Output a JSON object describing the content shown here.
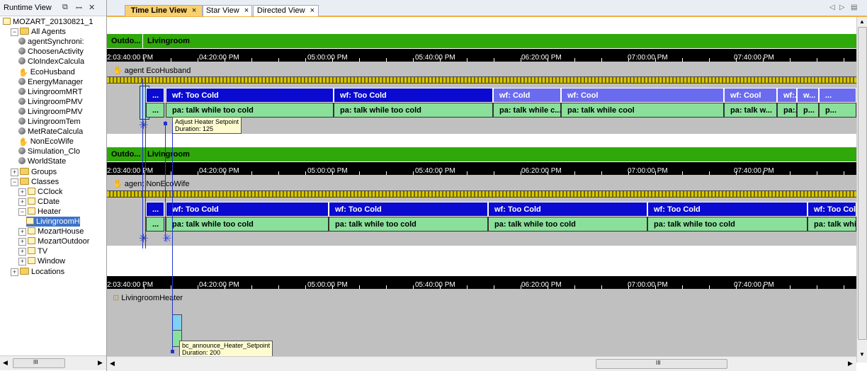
{
  "left_panel": {
    "title": "Runtime View",
    "icons": [
      "restore-icon",
      "pin-icon",
      "close-icon"
    ],
    "tree": [
      {
        "label": "MOZART_20130821_1",
        "icon": "db-icon",
        "level": 0
      },
      {
        "label": "All Agents",
        "icon": "folder-icon",
        "level": 1,
        "expanded": true
      },
      {
        "label": "agentSynchroni:",
        "icon": "ball-icon",
        "level": 2
      },
      {
        "label": "ChoosenActivity",
        "icon": "ball-icon",
        "level": 2
      },
      {
        "label": "CloIndexCalcula",
        "icon": "ball-icon",
        "level": 2
      },
      {
        "label": "EcoHusband",
        "icon": "hand-icon",
        "level": 2
      },
      {
        "label": "EnergyManager",
        "icon": "ball-icon",
        "level": 2
      },
      {
        "label": "LivingroomMRT",
        "icon": "ball-icon",
        "level": 2
      },
      {
        "label": "LivingroomPMV",
        "icon": "ball-icon",
        "level": 2
      },
      {
        "label": "LivingroomPMV",
        "icon": "ball-icon",
        "level": 2
      },
      {
        "label": "LivingroomTem",
        "icon": "ball-icon",
        "level": 2
      },
      {
        "label": "MetRateCalcula",
        "icon": "ball-icon",
        "level": 2
      },
      {
        "label": "NonEcoWife",
        "icon": "hand-icon",
        "level": 2
      },
      {
        "label": "Simulation_Clo",
        "icon": "ball-icon",
        "level": 2
      },
      {
        "label": "WorldState",
        "icon": "ball-icon",
        "level": 2
      },
      {
        "label": "Groups",
        "icon": "folder-icon",
        "level": 1,
        "expanded": false
      },
      {
        "label": "Classes",
        "icon": "folder-icon",
        "level": 1,
        "expanded": true
      },
      {
        "label": "CClock",
        "icon": "class-icon",
        "level": 2,
        "expanded": false
      },
      {
        "label": "CDate",
        "icon": "class-icon",
        "level": 2,
        "expanded": false
      },
      {
        "label": "Heater",
        "icon": "class-icon",
        "level": 2,
        "expanded": true
      },
      {
        "label": "LivingroomH",
        "icon": "class-icon",
        "level": 3,
        "selected": true
      },
      {
        "label": "MozartHouse",
        "icon": "class-icon",
        "level": 2,
        "expanded": false
      },
      {
        "label": "MozartOutdoor",
        "icon": "class-icon",
        "level": 2,
        "expanded": false
      },
      {
        "label": "TV",
        "icon": "class-icon",
        "level": 2,
        "expanded": false
      },
      {
        "label": "Window",
        "icon": "class-icon",
        "level": 2,
        "expanded": false
      },
      {
        "label": "Locations",
        "icon": "folder-icon",
        "level": 1,
        "expanded": false
      }
    ],
    "hscroll_label": "III"
  },
  "tabs": [
    {
      "label": "Time Line View",
      "active": true
    },
    {
      "label": "Star View",
      "active": false
    },
    {
      "label": "Directed View",
      "active": false
    }
  ],
  "tab_close": "×",
  "nav_arrows": {
    "left": "◁",
    "right": "▷",
    "menu": "▤"
  },
  "time_labels": [
    "2:03:40:00 PM",
    "04:20:00 PM",
    "05:00:00 PM",
    "05:40:00 PM",
    "06:20:00 PM",
    "07:00:00 PM",
    "07:40:00 PM"
  ],
  "section1": {
    "location_labels": [
      "Outdo...",
      "Livingroom"
    ],
    "agent_label": "agent EcoHusband",
    "wf": [
      "...",
      "wf: Too Cold",
      "wf: Too Cold",
      "wf: Cold",
      "wf: Cool",
      "wf: Cool",
      "wf:...",
      "w...",
      "..."
    ],
    "pa": [
      "...",
      "pa: talk while too cold",
      "pa: talk while too cold",
      "pa: talk while c...",
      "pa: talk while cool",
      "pa: talk w...",
      "pa:...",
      "p...",
      "p..."
    ],
    "tooltip": {
      "line1": "Adjust Heater Setpoint",
      "line2": "Duration: 125"
    }
  },
  "section2": {
    "location_labels": [
      "Outdo...",
      "Livingroom"
    ],
    "agent_label": "agent NonEcoWife",
    "wf": [
      "...",
      "wf: Too Cold",
      "wf: Too Cold",
      "wf: Too Cold",
      "wf: Too Cold",
      "wf: Too Col"
    ],
    "pa": [
      "...",
      "pa: talk while too cold",
      "pa: talk while too cold",
      "pa: talk while too cold",
      "pa: talk while too cold",
      "pa: talk whi"
    ]
  },
  "section3": {
    "object_label": "LivingroomHeater",
    "tooltip": {
      "line1": "bc_announce_Heater_Setpoint",
      "line2": "Duration: 200"
    }
  },
  "bottom_scroll_label": "III",
  "colors": {
    "green": "#2ea80a",
    "wf_dark": "#0a0ad0",
    "wf_light": "#6b6bf0",
    "pa": "#8ae09a",
    "grey": "#c0c0c0",
    "tab_active": "#f8d070"
  }
}
